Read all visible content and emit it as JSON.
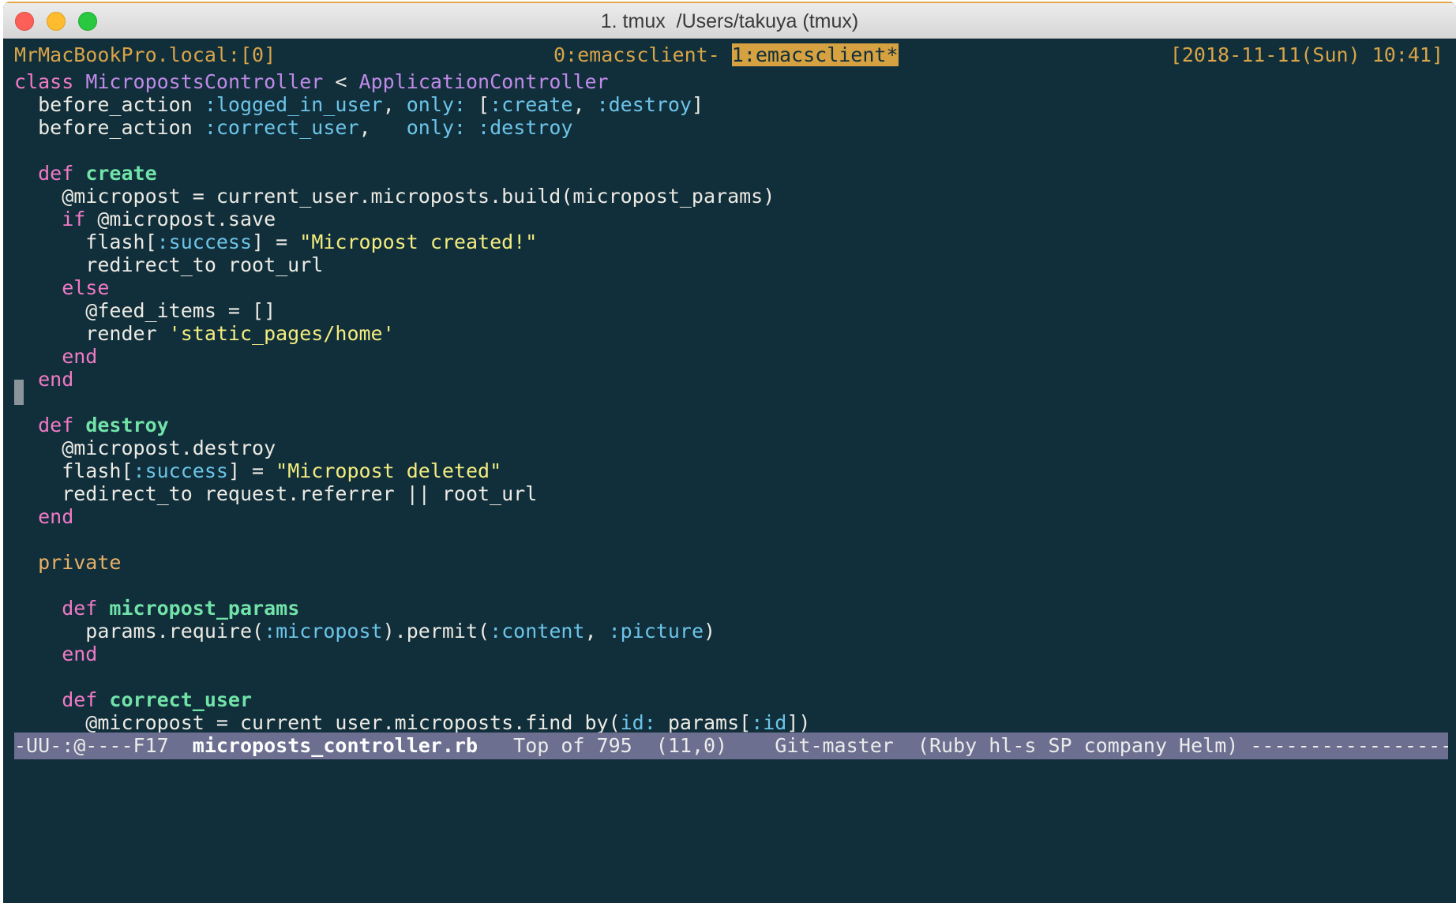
{
  "window": {
    "title": "1. tmux  /Users/takuya (tmux)"
  },
  "tmux_status": {
    "session": "MrMacBookPro.local:[0]",
    "window_inactive": "0:emacsclient-",
    "window_active": "1:emacsclient*",
    "datetime": "[2018-11-11(Sun) 10:41]"
  },
  "code": {
    "l1_kw": "class",
    "l1_sp1": " ",
    "l1_cls": "MicropostsController",
    "l1_mid": " < ",
    "l1_parent": "ApplicationController",
    "l2_a": "  before_action ",
    "l2_b": ":logged_in_user",
    "l2_c": ", ",
    "l2_d": "only:",
    "l2_e": " [",
    "l2_f": ":create",
    "l2_g": ", ",
    "l2_h": ":destroy",
    "l2_i": "]",
    "l3_a": "  before_action ",
    "l3_b": ":correct_user",
    "l3_c": ",   ",
    "l3_d": "only:",
    "l3_e": " ",
    "l3_f": ":destroy",
    "l5_kw": "  def ",
    "l5_fn": "create",
    "l6": "    @micropost = current_user.microposts.build(micropost_params)",
    "l7_kw": "    if",
    "l7_rest": " @micropost.save",
    "l8_a": "      flash[",
    "l8_b": ":success",
    "l8_c": "] = ",
    "l8_d": "\"Micropost created!\"",
    "l9": "      redirect_to root_url",
    "l10_kw": "    else",
    "l11": "      @feed_items = []",
    "l12_a": "      render ",
    "l12_b": "'static_pages/home'",
    "l13_kw": "    end",
    "l14_kw": "  end",
    "l16_kw": "  def ",
    "l16_fn": "destroy",
    "l17": "    @micropost.destroy",
    "l18_a": "    flash[",
    "l18_b": ":success",
    "l18_c": "] = ",
    "l18_d": "\"Micropost deleted\"",
    "l19": "    redirect_to request.referrer || root_url",
    "l20_kw": "  end",
    "l22_priv": "  private",
    "l24_kw": "    def ",
    "l24_fn": "micropost_params",
    "l25_a": "      params.require(",
    "l25_b": ":micropost",
    "l25_c": ").permit(",
    "l25_d": ":content",
    "l25_e": ", ",
    "l25_f": ":picture",
    "l25_g": ")",
    "l26_kw": "    end",
    "l28_kw": "    def ",
    "l28_fn": "correct_user",
    "l29_a": "      @micropost = current_user.microposts.find_by(",
    "l29_b": "id:",
    "l29_c": " params[",
    "l29_d": ":id",
    "l29_e": "])"
  },
  "modeline": {
    "state": "-UU-:@----F17  ",
    "filename": "microposts_controller.rb",
    "position": "   Top of 795  (11,0)    Git-master  (Ruby hl-s SP company Helm) ",
    "fill": "-------------------------------------------"
  },
  "colors": {
    "background": "#112f3b",
    "keyword": "#f07ac5",
    "function": "#72e3a8",
    "class": "#c08ae8",
    "symbol": "#6cc4e8",
    "string": "#f3ec7e",
    "private": "#e7b067",
    "status": "#d9a448",
    "modeline": "#6c6f8f"
  }
}
